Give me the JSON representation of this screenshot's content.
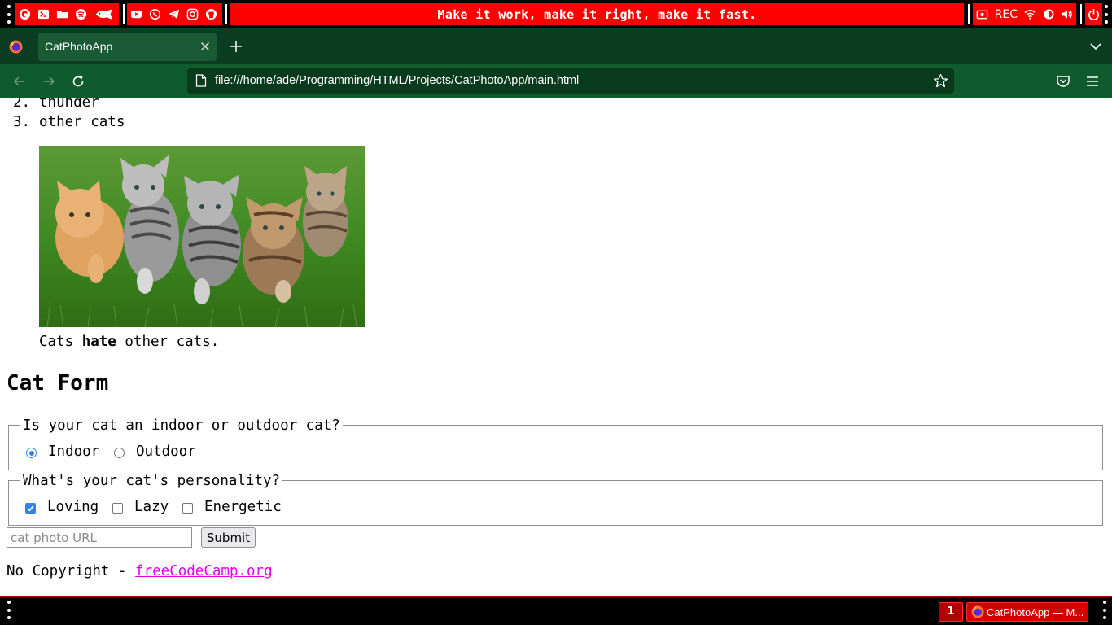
{
  "system_bar": {
    "motto": "Make it work, make it right, make it fast.",
    "recording_label": "REC",
    "launcher_icons": [
      "firefox-icon",
      "terminal-icon",
      "folder-icon",
      "spotify-icon",
      "fish-icon"
    ],
    "social_icons": [
      "youtube-icon",
      "whatsapp-icon",
      "telegram-icon",
      "instagram-icon",
      "github-icon"
    ],
    "status_icons": [
      "screenshot-icon",
      "wifi-icon",
      "brightness-icon",
      "volume-icon"
    ],
    "power_icon": "power-icon",
    "colors": {
      "bar_background": "#000000",
      "segment_accent": "#ff0000"
    }
  },
  "browser": {
    "tab_title": "CatPhotoApp",
    "url": "file:///home/ade/Programming/HTML/Projects/CatPhotoApp/main.html",
    "colors": {
      "tabstrip": "#0b3d23",
      "toolbar": "#0f5b2e",
      "urlbar": "#083a1c"
    }
  },
  "page": {
    "list_items": [
      {
        "number": "2.",
        "text": "thunder"
      },
      {
        "number": "3.",
        "text": "other cats"
      }
    ],
    "image_alt": "five kittens on green grass",
    "caption": {
      "before": "Cats ",
      "bold": "hate",
      "after": " other cats."
    },
    "form_title": "Cat Form",
    "indoor_outdoor": {
      "legend": "Is your cat an indoor or outdoor cat?",
      "options": [
        {
          "label": "Indoor",
          "checked": true
        },
        {
          "label": "Outdoor",
          "checked": false
        }
      ]
    },
    "personality": {
      "legend": "What's your cat's personality?",
      "options": [
        {
          "label": "Loving",
          "checked": true
        },
        {
          "label": "Lazy",
          "checked": false
        },
        {
          "label": "Energetic",
          "checked": false
        }
      ]
    },
    "url_input": {
      "placeholder": "cat photo URL",
      "value": ""
    },
    "submit_label": "Submit",
    "footer": {
      "text": "No Copyright - ",
      "link_text": "freeCodeCamp.org",
      "link_color": "#e600e6"
    },
    "accent_color": "#3584e4"
  },
  "taskbar": {
    "workspace": "1",
    "window_title": "CatPhotoApp — M..."
  }
}
